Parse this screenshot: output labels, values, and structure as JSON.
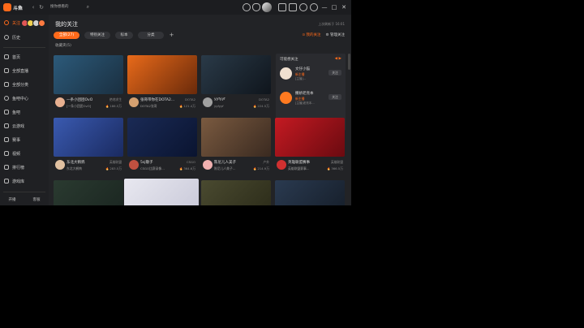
{
  "titlebar": {
    "logo_text": "斗鱼",
    "search_placeholder": "搜你想看的",
    "back_glyph": "‹",
    "refresh_glyph": "↻",
    "search_glyph": "⌕",
    "icons": [
      "clock-icon",
      "heart-icon",
      "message-icon",
      "task-icon",
      "chat-icon",
      "settings-icon"
    ],
    "window_glyphs": [
      "—",
      "□",
      "✕"
    ]
  },
  "sidebar": {
    "items": [
      {
        "label": "关注",
        "active": true
      },
      {
        "label": "历史",
        "active": false
      },
      {
        "label": "首页",
        "active": false
      },
      {
        "label": "全部直播",
        "active": false
      },
      {
        "label": "全部分类",
        "active": false
      },
      {
        "label": "鱼吧中心",
        "active": false
      },
      {
        "label": "鱼吧",
        "active": false
      },
      {
        "label": "云游戏",
        "active": false
      },
      {
        "label": "赛事",
        "active": false
      },
      {
        "label": "视频",
        "active": false
      },
      {
        "label": "排行榜",
        "active": false
      },
      {
        "label": "游戏库",
        "active": false
      }
    ],
    "bottom": [
      "开播",
      "客服"
    ],
    "avatar_colors": [
      "#e05555",
      "#f0d050",
      "#cfcfcf",
      "#ff7a40"
    ]
  },
  "main": {
    "title": "我的关注",
    "update_time": "上次刷新于 16:01",
    "filters": [
      {
        "label": "全部(27)",
        "active": true
      },
      {
        "label": "特别关注",
        "active": false
      },
      {
        "label": "标本",
        "active": false
      },
      {
        "label": "分类",
        "active": false
      }
    ],
    "add_filter_glyph": "+",
    "quick_links": [
      "⊙ 我的关注",
      "⚙ 管理关注"
    ],
    "collect_label": "收藏夹(5)"
  },
  "cards": [
    {
      "title": "一条小团团OvO",
      "cat": "绝地求生",
      "name": "[一条小团团OvO]",
      "hot": "186.5万",
      "thumb": "#2c5a7a",
      "thumb2": "#1a2f40",
      "avatar": "#e8b090"
    },
    {
      "title": "张哥带你在DOTA2...",
      "cat": "DOTA2",
      "name": "DOTA2张哥",
      "hot": "121.4万",
      "thumb": "#e86a1a",
      "thumb2": "#6a2a0a",
      "avatar": "#d4a070"
    },
    {
      "title": "yyfyyf",
      "cat": "DOTA2",
      "name": "yyfyyf",
      "hot": "224.5万",
      "thumb": "#2a3a48",
      "thumb2": "#0f151c",
      "avatar": "#a0a0a0"
    },
    {
      "title": "东北大鹌鹑",
      "cat": "英雄联盟",
      "name": "东北大鹌鹑",
      "hot": "283.5万",
      "thumb": "#3a5ab0",
      "thumb2": "#1a2a60",
      "avatar": "#e0c0a0"
    },
    {
      "title": "5sj敬子",
      "cat": "CSGO",
      "name": "CSGO比赛录像...",
      "hot": "364.6万",
      "thumb": "#1a2a55",
      "thumb2": "#0a1430",
      "avatar": "#c05040"
    },
    {
      "title": "陈尼儿人美子",
      "cat": "户外",
      "name": "陈尼儿人美子...",
      "hot": "214.9万",
      "thumb": "#7a5a40",
      "thumb2": "#3a2a20",
      "avatar": "#f0b0b0"
    },
    {
      "title": "英雄联盟赛事",
      "cat": "英雄联盟",
      "name": "英雄联盟赛事...",
      "hot": "366.5万",
      "thumb": "#c41a22",
      "thumb2": "#6a0a10",
      "avatar": "#d03030"
    },
    {
      "title": "",
      "cat": "",
      "name": "",
      "hot": "",
      "thumb": "#2a3a30",
      "thumb2": "#1a2520",
      "avatar": "#555"
    },
    {
      "title": "",
      "cat": "",
      "name": "",
      "hot": "",
      "thumb": "#e8e8f0",
      "thumb2": "#c8c8d8",
      "avatar": "#555"
    },
    {
      "title": "",
      "cat": "",
      "name": "",
      "hot": "",
      "thumb": "#4a4a30",
      "thumb2": "#2a2a18",
      "avatar": "#555"
    },
    {
      "title": "",
      "cat": "",
      "name": "",
      "hot": "",
      "thumb": "#2a3a50",
      "thumb2": "#151d28",
      "avatar": "#555"
    }
  ],
  "follow_panel": {
    "title": "可能想关注",
    "controls": "◀ ▶",
    "items": [
      {
        "name": "文仔小猫",
        "tag": "新主播",
        "sub": "[主播]...",
        "btn": "关注",
        "avatar": "#f0e0d0"
      },
      {
        "name": "撒娇老亮本",
        "tag": "新主播",
        "sub": "[主播]老亮本...",
        "btn": "关注",
        "avatar": "#ff7a20"
      }
    ]
  }
}
